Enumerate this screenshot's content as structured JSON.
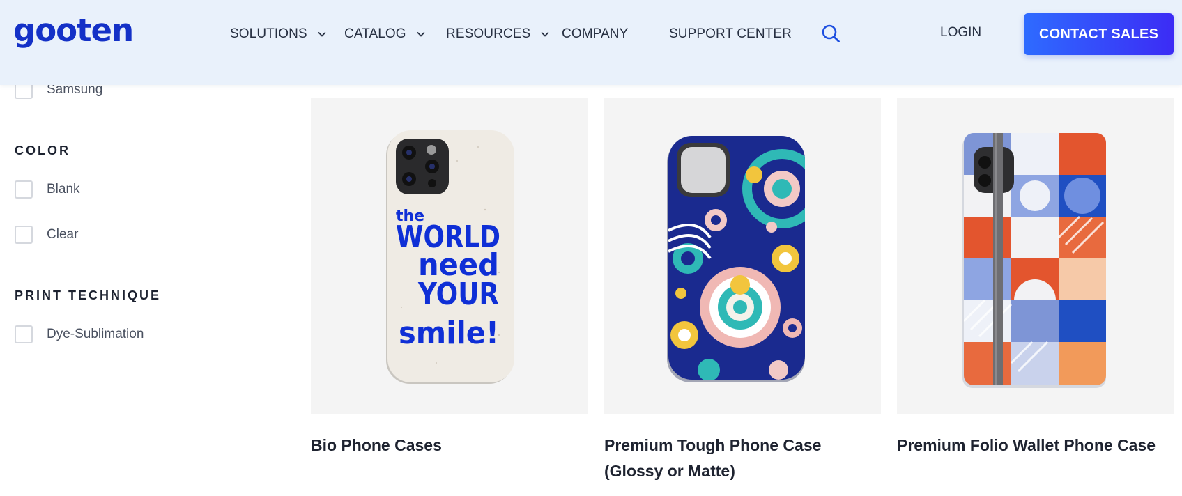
{
  "header": {
    "logo": "gooten",
    "nav": [
      {
        "label": "SOLUTIONS",
        "dropdown": true
      },
      {
        "label": "CATALOG",
        "dropdown": true
      },
      {
        "label": "RESOURCES",
        "dropdown": true
      },
      {
        "label": "COMPANY",
        "dropdown": false
      },
      {
        "label": "SUPPORT CENTER",
        "dropdown": false
      }
    ],
    "search_icon": "search-icon",
    "login": "LOGIN",
    "contact_sales": "CONTACT SALES"
  },
  "filters": {
    "brand_options": [
      {
        "label": "Samsung",
        "checked": false
      }
    ],
    "color": {
      "heading": "COLOR",
      "options": [
        {
          "label": "Blank",
          "checked": false
        },
        {
          "label": "Clear",
          "checked": false
        }
      ]
    },
    "print_technique": {
      "heading": "PRINT TECHNIQUE",
      "options": [
        {
          "label": "Dye-Sublimation",
          "checked": false
        }
      ]
    }
  },
  "products": [
    {
      "title": "Bio Phone Cases",
      "image_text": [
        "the",
        "WORLD",
        "need",
        "YOUR",
        "smile!"
      ]
    },
    {
      "title": "Premium Tough Phone Case (Glossy or Matte)"
    },
    {
      "title": "Premium Folio Wallet Phone Case"
    }
  ],
  "colors": {
    "brand": "#1431c7",
    "header_bg": "#e9f1fb",
    "cta_start": "#2e6bff",
    "cta_end": "#3c2cf5",
    "card_bg": "#f4f4f4"
  }
}
